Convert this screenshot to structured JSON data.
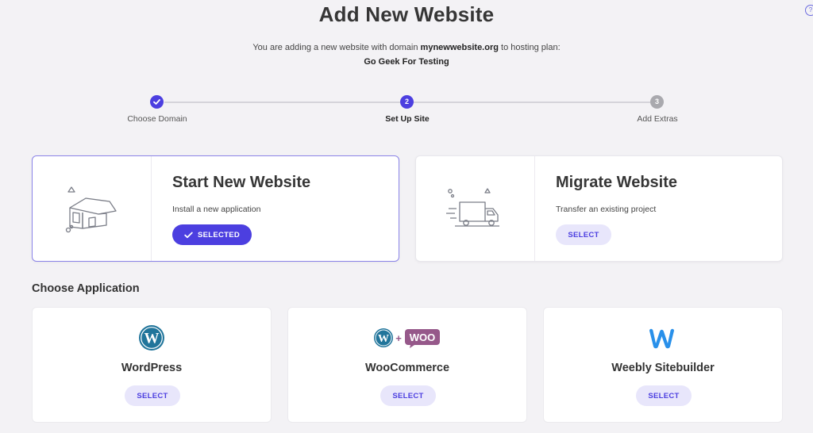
{
  "header": {
    "title": "Add New Website",
    "subtitle_prefix": "You are adding a new website with domain ",
    "domain": "mynewwebsite.org",
    "subtitle_suffix": " to hosting plan:",
    "plan": "Go Geek For Testing"
  },
  "stepper": {
    "steps": [
      {
        "number": "",
        "label": "Choose Domain",
        "state": "done"
      },
      {
        "number": "2",
        "label": "Set Up Site",
        "state": "current"
      },
      {
        "number": "3",
        "label": "Add Extras",
        "state": "upcoming"
      }
    ]
  },
  "options": [
    {
      "title": "Start New Website",
      "description": "Install a new application",
      "button": "SELECTED",
      "selected": true,
      "icon": "house-icon"
    },
    {
      "title": "Migrate Website",
      "description": "Transfer an existing project",
      "button": "SELECT",
      "selected": false,
      "icon": "truck-icon"
    }
  ],
  "applications": {
    "heading": "Choose Application",
    "items": [
      {
        "name": "WordPress",
        "button": "SELECT",
        "icon": "wordpress-icon"
      },
      {
        "name": "WooCommerce",
        "button": "SELECT",
        "icon": "woocommerce-icon"
      },
      {
        "name": "Weebly Sitebuilder",
        "button": "SELECT",
        "icon": "weebly-icon"
      }
    ]
  },
  "colors": {
    "accent": "#4c3fe0",
    "accent_light": "#e8e6fb",
    "background": "#f3f2f5",
    "wordpress_blue": "#21759b",
    "woo_purple": "#96588a",
    "weebly_blue": "#2990ea"
  }
}
